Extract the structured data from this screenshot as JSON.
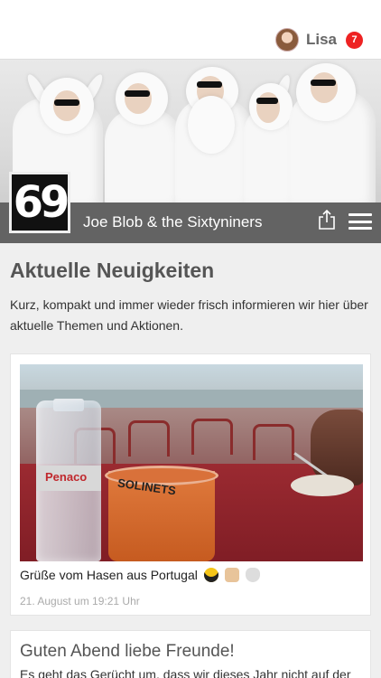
{
  "header": {
    "user_name": "Lisa",
    "notification_count": "7",
    "icons": [
      "avatar-icon"
    ]
  },
  "band": {
    "logo_text": "69",
    "name": "Joe Blob & the Sixtyniners",
    "icons": [
      "share-icon",
      "menu-icon"
    ]
  },
  "news": {
    "title": "Aktuelle Neuigkeiten",
    "intro": "Kurz, kompakt und immer wieder frisch informieren wir hier über aktuelle Themen und Aktionen."
  },
  "posts": [
    {
      "photo_text": {
        "bottle_label": "Penaco",
        "glass_label": "SOLINETS"
      },
      "caption": "Grüße vom Hasen aus Portugal",
      "emoji": [
        "sunglasses-emoji",
        "thumbs-up-emoji",
        "rabbit-emoji"
      ],
      "date": "21. August um 19:21 Uhr"
    },
    {
      "title": "Guten Abend liebe Freunde!",
      "text": "Es geht das Gerücht um, dass wir dieses Jahr nicht auf der"
    }
  ],
  "colors": {
    "badge": "#e22222",
    "brandbar": "#505050",
    "background": "#efefef"
  }
}
